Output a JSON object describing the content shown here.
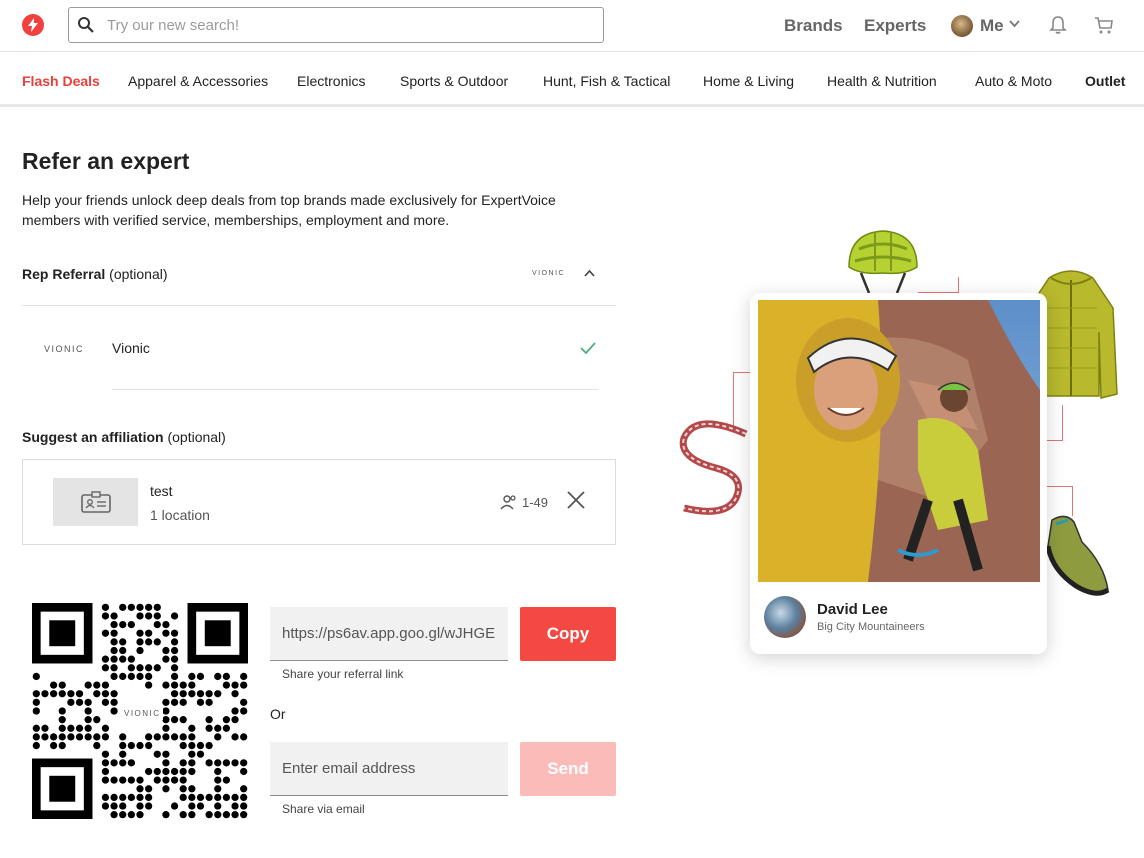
{
  "header": {
    "search_placeholder": "Try our new search!",
    "nav_brands": "Brands",
    "nav_experts": "Experts",
    "nav_me": "Me"
  },
  "categories": [
    {
      "label": "Flash Deals"
    },
    {
      "label": "Apparel & Accessories"
    },
    {
      "label": "Electronics"
    },
    {
      "label": "Sports & Outdoor"
    },
    {
      "label": "Hunt, Fish & Tactical"
    },
    {
      "label": "Home & Living"
    },
    {
      "label": "Health & Nutrition"
    },
    {
      "label": "Auto & Moto"
    },
    {
      "label": "Outlet"
    }
  ],
  "page": {
    "title": "Refer an expert",
    "description": "Help your friends unlock deep deals from top brands made exclusively for ExpertVoice members with verified service, memberships, employment and more."
  },
  "rep_referral": {
    "label": "Rep Referral",
    "optional": " (optional)",
    "selected_logo": "VIONIC",
    "option_logo": "VIONIC",
    "option_name": "Vionic"
  },
  "affiliation": {
    "label": "Suggest an affiliation",
    "optional": " (optional)",
    "name": "test",
    "locations": "1 location",
    "size": "1-49"
  },
  "share": {
    "qr_logo": "VIONIC",
    "link_value": "https://ps6av.app.goo.gl/wJHGE",
    "link_hint": "Share your referral link",
    "copy_label": "Copy",
    "or_label": "Or",
    "email_placeholder": "Enter email address",
    "email_hint": "Share via email",
    "send_label": "Send"
  },
  "expert_card": {
    "name": "David Lee",
    "organization": "Big City Mountaineers"
  },
  "colors": {
    "brand_red": "#f44943",
    "brand_red_disabled": "#fbbcb9",
    "check_green": "#4caf7a"
  }
}
